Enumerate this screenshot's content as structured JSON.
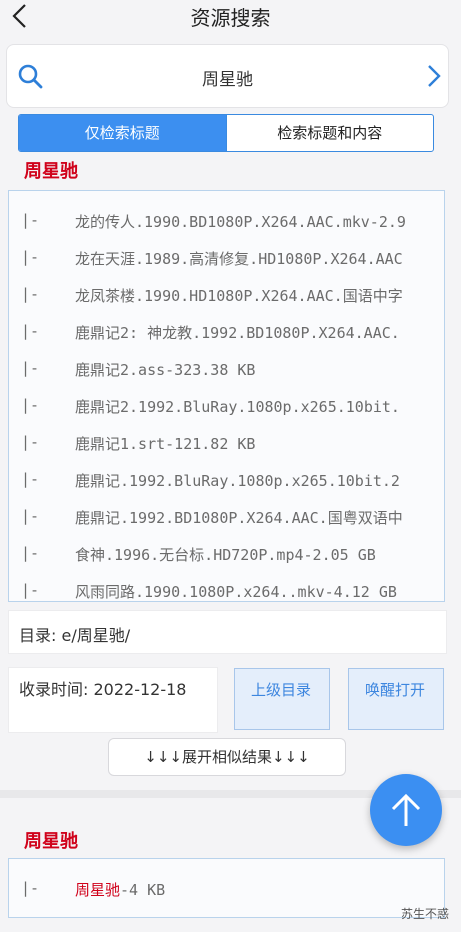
{
  "header": {
    "title": "资源搜索"
  },
  "search": {
    "query": "周星驰"
  },
  "mode_tabs": [
    {
      "label": "仅检索标题",
      "active": true
    },
    {
      "label": "检索标题和内容",
      "active": false
    }
  ],
  "results": [
    {
      "title": "周星驰",
      "files": [
        {
          "prefix": "|-",
          "name": "龙的传人.1990.BD1080P.X264.AAC.mkv-2.9"
        },
        {
          "prefix": "|-",
          "name": "龙在天涯.1989.高清修复.HD1080P.X264.AAC"
        },
        {
          "prefix": "|-",
          "name": "龙凤茶楼.1990.HD1080P.X264.AAC.国语中字"
        },
        {
          "prefix": "|-",
          "name": "鹿鼎记2: 神龙教.1992.BD1080P.X264.AAC."
        },
        {
          "prefix": "|-",
          "name": "鹿鼎记2.ass-323.38 KB"
        },
        {
          "prefix": "|-",
          "name": "鹿鼎记2.1992.BluRay.1080p.x265.10bit."
        },
        {
          "prefix": "|-",
          "name": "鹿鼎记1.srt-121.82 KB"
        },
        {
          "prefix": "|-",
          "name": "鹿鼎记.1992.BluRay.1080p.x265.10bit.2"
        },
        {
          "prefix": "|-",
          "name": "鹿鼎记.1992.BD1080P.X264.AAC.国粤双语中"
        },
        {
          "prefix": "|-",
          "name": "食神.1996.无台标.HD720P.mp4-2.05 GB"
        },
        {
          "prefix": "|-",
          "name": "风雨同路.1990.1080P.x264..mkv-4.12 GB"
        }
      ],
      "directory": "目录: e/周星驰/",
      "collected_time": "收录时间: 2022-12-18",
      "parent_dir_button": "上级目录",
      "wake_open_button": "唤醒打开",
      "expand_label": "↓↓↓展开相似结果↓↓↓"
    },
    {
      "title": "周星驰",
      "files": [
        {
          "prefix": "|-",
          "highlight": "周星驰",
          "suffix": "-4 KB"
        }
      ]
    }
  ],
  "watermark": "苏生不惑",
  "colors": {
    "accent": "#3c8ff0",
    "highlight": "#d0021b"
  },
  "icons": {
    "back": "chevron-left-icon",
    "search": "search-icon",
    "go": "chevron-right-icon",
    "top": "arrow-up-icon"
  }
}
